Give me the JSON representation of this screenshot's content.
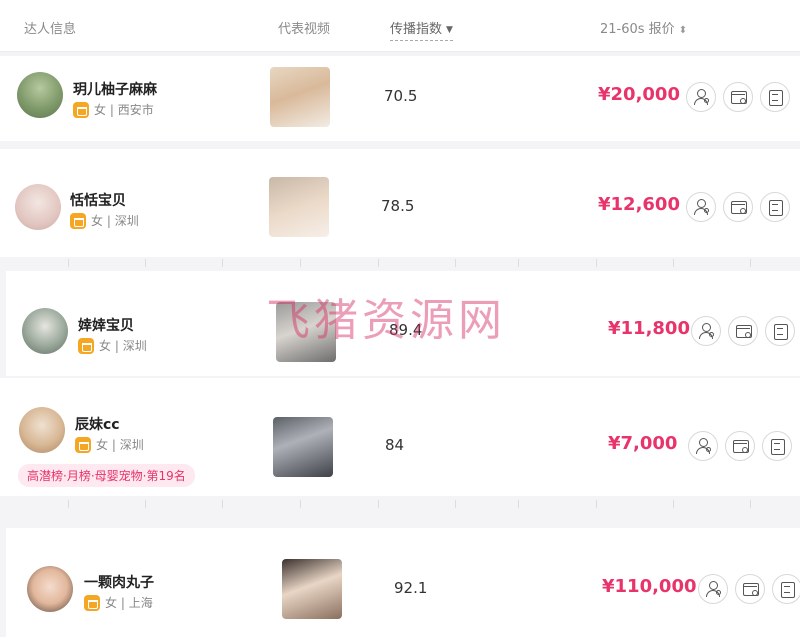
{
  "header": {
    "col_info": "达人信息",
    "col_video": "代表视频",
    "col_index": "传播指数",
    "col_price": "21-60s 报价",
    "index_sort_icon": "caret-down-icon",
    "price_sort_icon": "sort-updown-icon"
  },
  "rows": [
    {
      "name": "玥儿柚子麻麻",
      "gender": "女",
      "city": "西安市",
      "index": "70.5",
      "price": "¥20,000",
      "badge": ""
    },
    {
      "name": "恬恬宝贝",
      "gender": "女",
      "city": "深圳",
      "index": "78.5",
      "price": "¥12,600",
      "badge": ""
    },
    {
      "name": "婞婞宝贝",
      "gender": "女",
      "city": "深圳",
      "index": "89.4",
      "price": "¥11,800",
      "badge": ""
    },
    {
      "name": "辰妹cc",
      "gender": "女",
      "city": "深圳",
      "index": "84",
      "price": "¥7,000",
      "badge": "高潜榜·月榜·母婴宠物·第19名"
    },
    {
      "name": "一颗肉丸子",
      "gender": "女",
      "city": "上海",
      "index": "92.1",
      "price": "¥110,000",
      "badge": ""
    }
  ],
  "meta_separator": "|",
  "action_icons": [
    "user-search-icon",
    "card-icon",
    "bill-icon"
  ],
  "watermark": "飞猪资源网",
  "colors": {
    "price": "#e8336b",
    "badge_bg": "#fde9ef",
    "shop_badge": "#f5a623"
  }
}
